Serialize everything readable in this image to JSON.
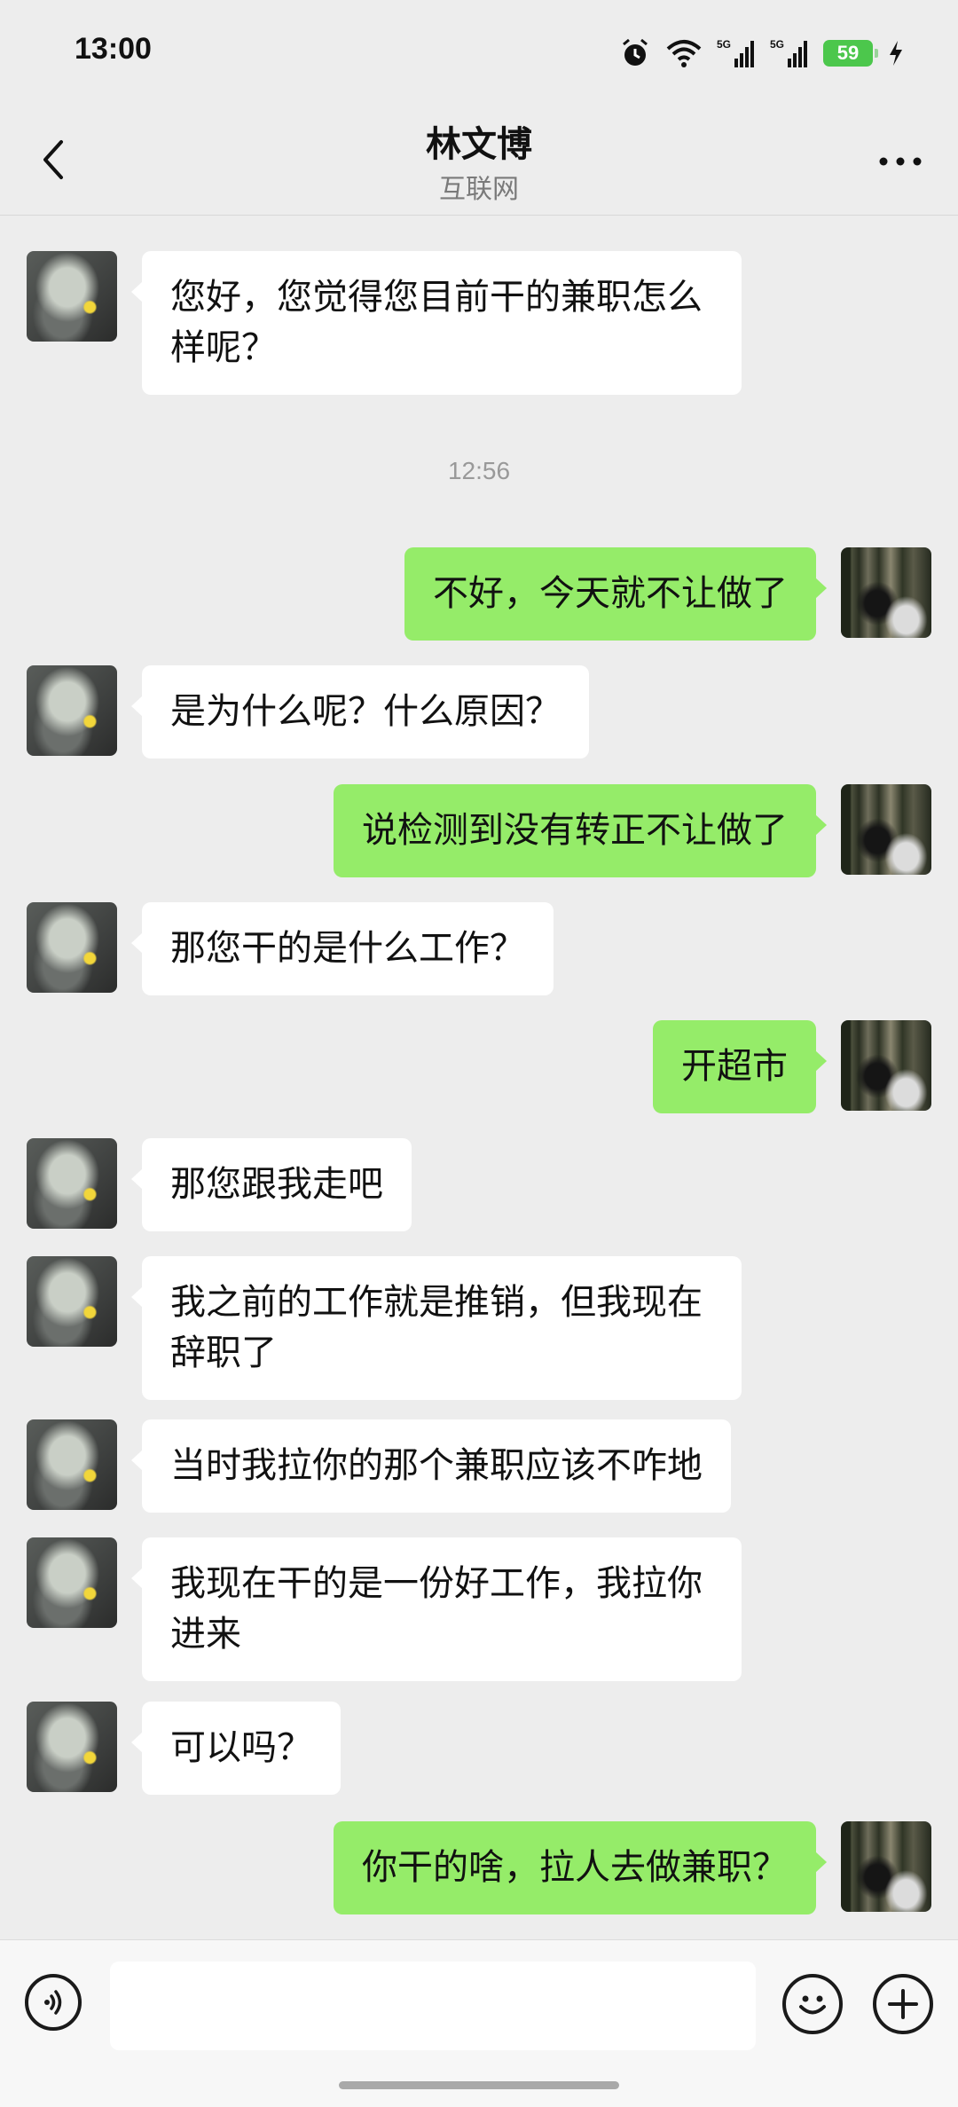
{
  "status_bar": {
    "time": "13:00",
    "battery": "59",
    "icons": [
      "alarm-icon",
      "wifi-icon",
      "signal-5g-icon",
      "signal-5g-icon",
      "battery-icon",
      "charging-icon"
    ]
  },
  "header": {
    "title": "林文博",
    "subtitle": "互联网"
  },
  "chat": {
    "timestamp": "12:56",
    "messages": [
      {
        "from": "other",
        "text": "您好，您觉得您目前干的兼职怎么样呢？"
      },
      {
        "from": "me",
        "text": "不好，今天就不让做了"
      },
      {
        "from": "other",
        "text": "是为什么呢？什么原因？"
      },
      {
        "from": "me",
        "text": "说检测到没有转正不让做了"
      },
      {
        "from": "other",
        "text": "那您干的是什么工作？"
      },
      {
        "from": "me",
        "text": "开超市"
      },
      {
        "from": "other",
        "text": "那您跟我走吧"
      },
      {
        "from": "other",
        "text": "我之前的工作就是推销，但我现在辞职了"
      },
      {
        "from": "other",
        "text": "当时我拉你的那个兼职应该不咋地"
      },
      {
        "from": "other",
        "text": "我现在干的是一份好工作，我拉你进来"
      },
      {
        "from": "other",
        "text": "可以吗？"
      },
      {
        "from": "me",
        "text": "你干的啥，拉人去做兼职？"
      }
    ]
  },
  "input_bar": {
    "value": "",
    "icons": [
      "voice-icon",
      "emoji-icon",
      "plus-icon"
    ]
  },
  "colors": {
    "background": "#ededed",
    "my_bubble": "#95ec69",
    "their_bubble": "#ffffff",
    "battery": "#4cc74c"
  }
}
